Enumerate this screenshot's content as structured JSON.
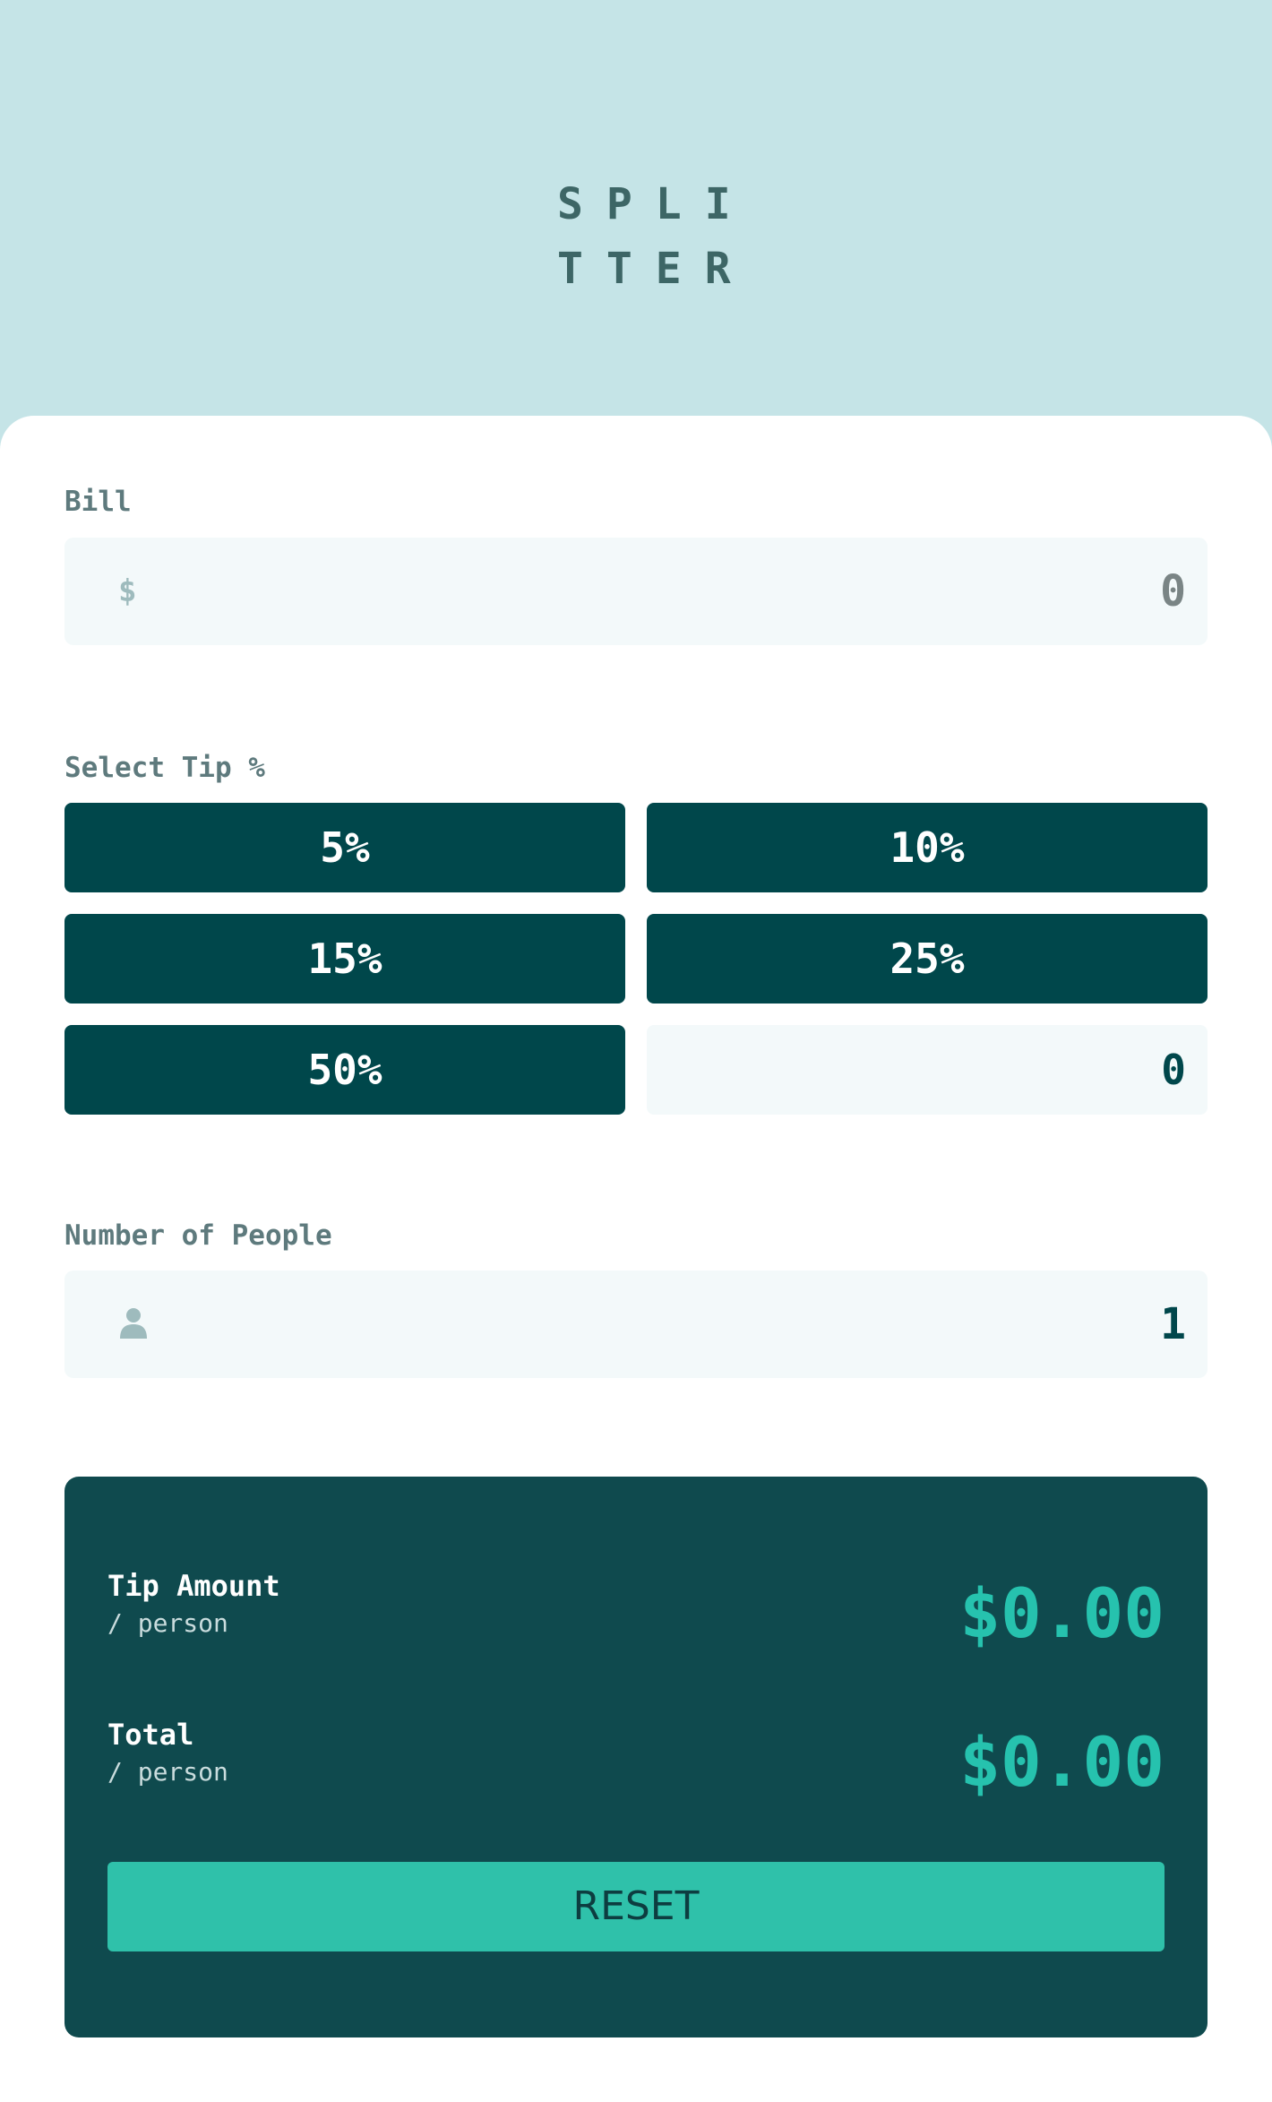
{
  "app": {
    "logo_line1": "SPLI",
    "logo_line2": "TTER"
  },
  "bill": {
    "label": "Bill",
    "prefix": "$",
    "value": "0"
  },
  "tip": {
    "label": "Select Tip %",
    "options": [
      "5%",
      "10%",
      "15%",
      "25%",
      "50%"
    ],
    "custom_value": "0"
  },
  "people": {
    "label": "Number of People",
    "icon": "person-icon",
    "value": "1"
  },
  "result": {
    "tip_title": "Tip Amount",
    "tip_sub": "/ person",
    "tip_amount": "$0.00",
    "total_title": "Total",
    "total_sub": "/ person",
    "total_amount": "$0.00",
    "reset_label": "RESET"
  },
  "colors": {
    "background": "#c5e4e7",
    "dark_cyan": "#00474b",
    "strong_cyan": "#26c2ae",
    "input_bg": "#f3f9fa"
  }
}
